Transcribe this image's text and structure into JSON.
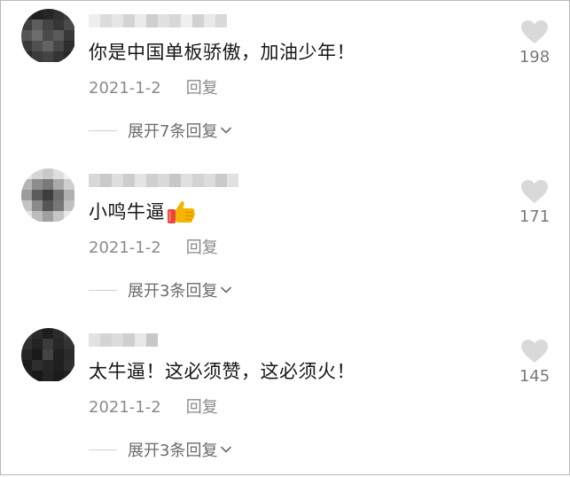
{
  "comments": [
    {
      "text": "你是中国单板骄傲，加油少年！",
      "date": "2021-1-2",
      "reply": "回复",
      "expand": "展开7条回复",
      "likes": "198",
      "icons": {
        "like": "heart-icon",
        "chevron": "chevron-down-icon"
      }
    },
    {
      "text": "小鸣牛逼",
      "emoji": "thumbs-up-icon",
      "date": "2021-1-2",
      "reply": "回复",
      "expand": "展开3条回复",
      "likes": "171",
      "icons": {
        "like": "heart-icon",
        "chevron": "chevron-down-icon"
      }
    },
    {
      "text": "太牛逼！这必须赞，这必须火！",
      "date": "2021-1-2",
      "reply": "回复",
      "expand": "展开3条回复",
      "likes": "145",
      "icons": {
        "like": "heart-icon",
        "chevron": "chevron-down-icon"
      }
    }
  ],
  "colors": {
    "text": "#161616",
    "meta": "#8a8a8a",
    "heart": "#d9d9d9",
    "thumb": "#f5b400",
    "cuff": "#e8453c"
  }
}
